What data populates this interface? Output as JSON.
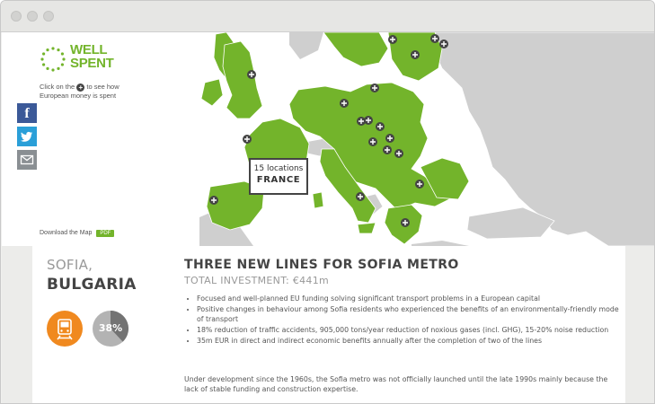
{
  "logo": {
    "line1": "WELL",
    "line2": "SPENT"
  },
  "hint": {
    "before": "Click on the",
    "plus": "+",
    "after": "to see how European money is spent"
  },
  "social": {
    "facebook": "f"
  },
  "download": {
    "label": "Download the Map",
    "pdf": "PDF"
  },
  "callout": {
    "locations": "15 locations",
    "country": "FRANCE"
  },
  "project": {
    "city": "SOFIA,",
    "country": "BULGARIA",
    "percent": "38%",
    "percent_value": 38,
    "title": "THREE NEW LINES FOR SOFIA METRO",
    "investment": "TOTAL INVESTMENT: €441m",
    "bullets": [
      "Focused and well-planned EU funding solving significant transport problems in a European capital",
      "Positive changes in behaviour among Sofia residents who experienced the benefits of an environmentally-friendly mode of transport",
      "18% reduction of traffic accidents, 905,000 tons/year reduction of noxious gases (incl. GHG), 15-20% noise reduction",
      "35m EUR in direct and indirect economic benefits annually after the completion of two of the lines"
    ],
    "description": "Under development since the 1960s, the Sofia metro was not officially launched until the late 1990s mainly because the lack of stable funding and construction expertise."
  },
  "colors": {
    "green": "#73b42b",
    "orange": "#f0891f",
    "gray_land": "#cfcfcf",
    "marker": "#444444"
  },
  "icons": {
    "tram": "tram-icon",
    "marker": "plus-icon"
  }
}
